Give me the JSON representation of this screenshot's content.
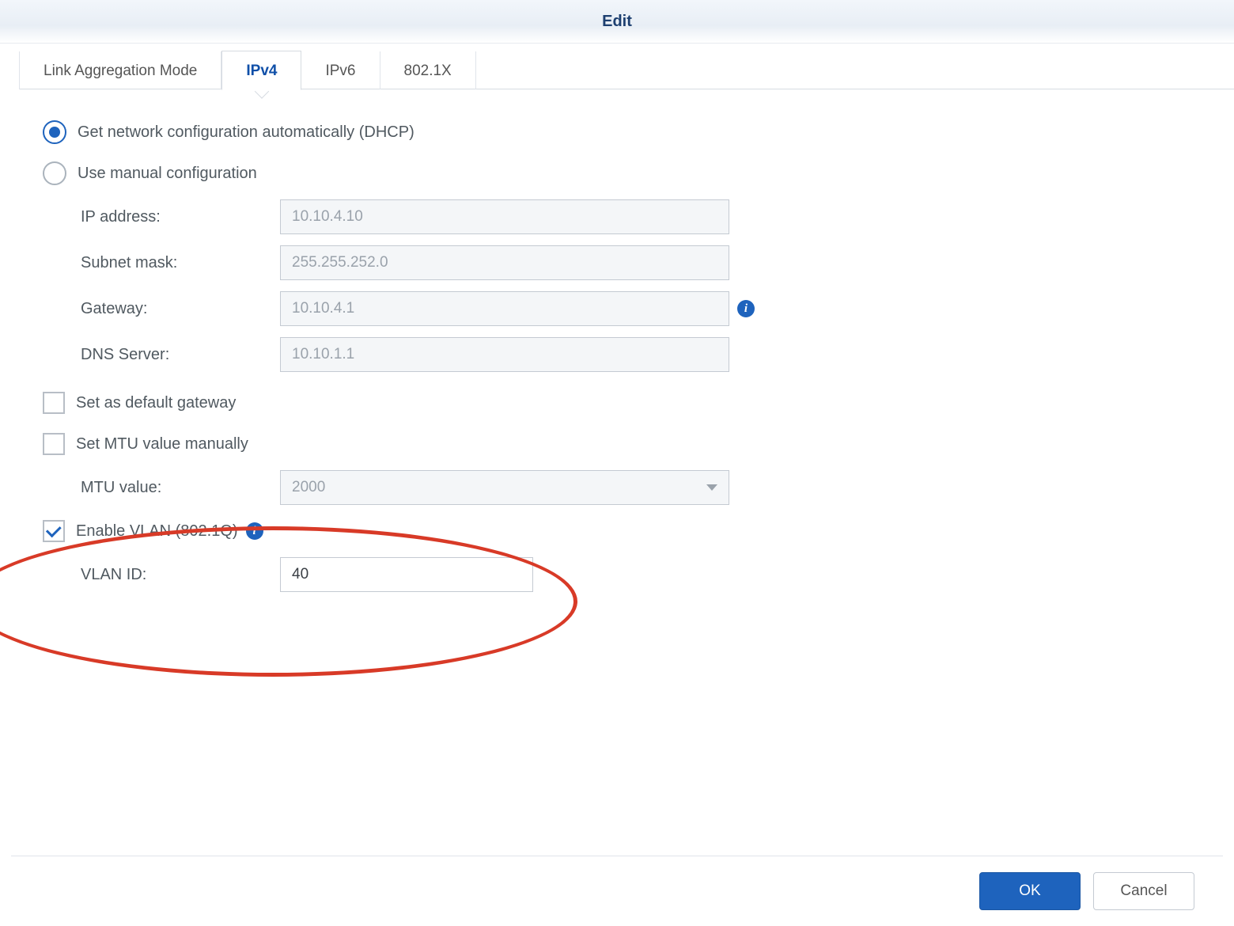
{
  "window": {
    "title": "Edit"
  },
  "tabs": {
    "items": [
      {
        "label": "Link Aggregation Mode"
      },
      {
        "label": "IPv4"
      },
      {
        "label": "IPv6"
      },
      {
        "label": "802.1X"
      }
    ],
    "active_index": 1
  },
  "ipv4": {
    "mode": "dhcp",
    "dhcp_label": "Get network configuration automatically (DHCP)",
    "manual_label": "Use manual configuration",
    "fields": {
      "ip_label": "IP address:",
      "ip_value": "10.10.4.10",
      "subnet_label": "Subnet mask:",
      "subnet_value": "255.255.252.0",
      "gateway_label": "Gateway:",
      "gateway_value": "10.10.4.1",
      "dns_label": "DNS Server:",
      "dns_value": "10.10.1.1"
    },
    "default_gateway": {
      "label": "Set as default gateway",
      "checked": false
    },
    "mtu": {
      "manual_label": "Set MTU value manually",
      "manual_checked": false,
      "value_label": "MTU value:",
      "value": "2000"
    },
    "vlan": {
      "enable_label": "Enable VLAN (802.1Q)",
      "enable_checked": true,
      "id_label": "VLAN ID:",
      "id_value": "40"
    }
  },
  "buttons": {
    "ok": "OK",
    "cancel": "Cancel"
  }
}
